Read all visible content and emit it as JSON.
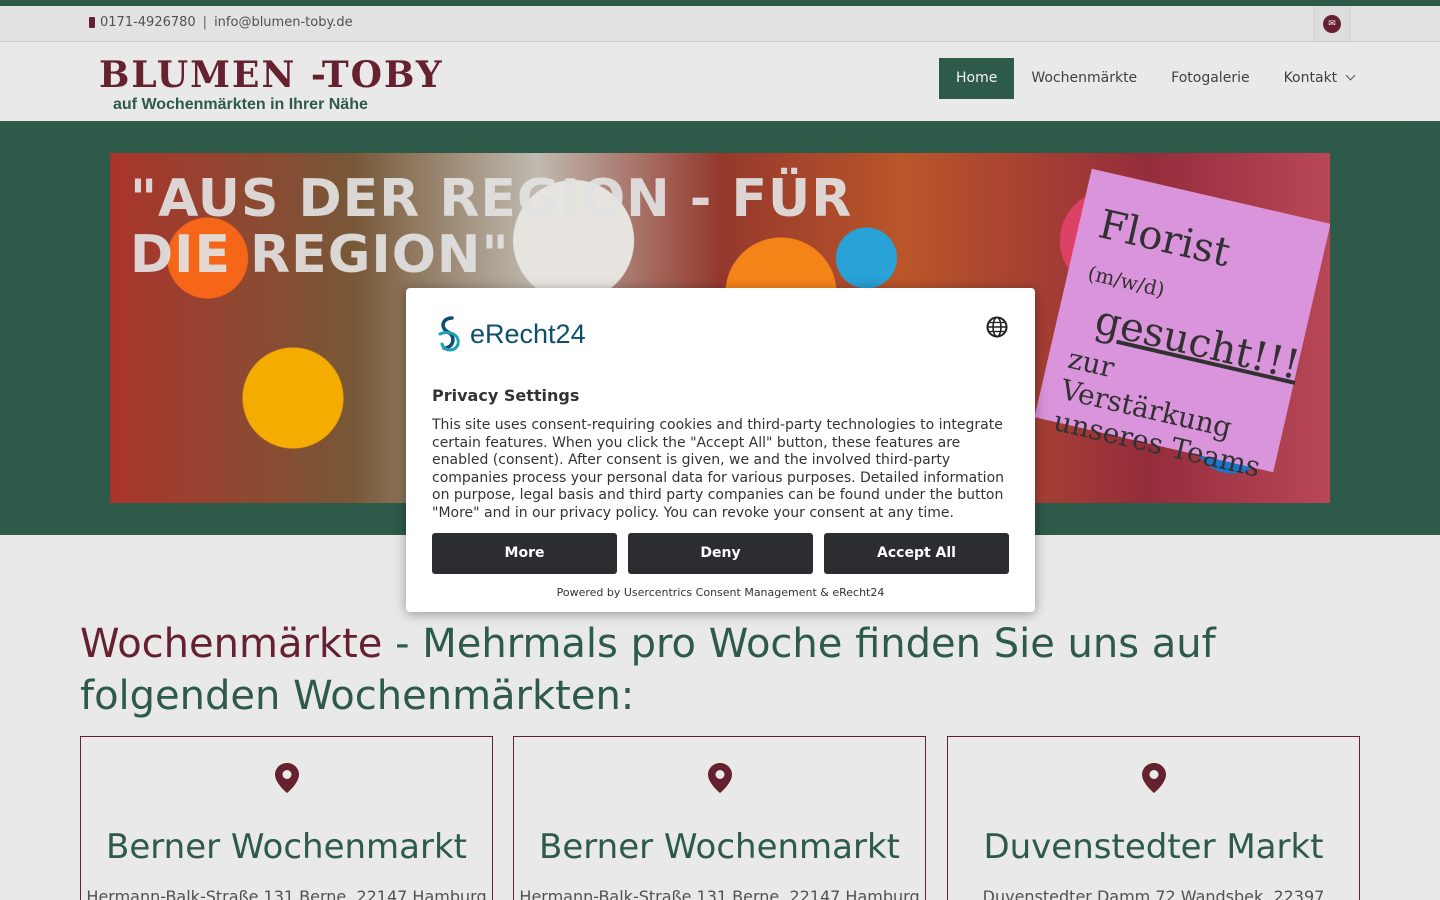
{
  "topbar": {
    "phone": "0171-4926780",
    "separator": "|",
    "email": "info@blumen-toby.de",
    "phone_icon": "mobile-phone-icon",
    "mail_icon": "envelope-icon"
  },
  "header": {
    "logo_title": "BLUMEN -TOBY",
    "logo_subtitle": "auf Wochenmärkten in Ihrer Nähe",
    "nav": [
      {
        "label": "Home",
        "active": true
      },
      {
        "label": "Wochenmärkte"
      },
      {
        "label": "Fotogalerie"
      },
      {
        "label": "Kontakt",
        "dropdown": true
      }
    ]
  },
  "hero": {
    "title": "\"AUS DER REGION - FÜR DIE REGION\"",
    "note_line1": "Florist",
    "note_line1_small": "(m/w/d)",
    "note_line2": "gesucht!!!",
    "note_line3": "zur Verstärkung unseres Teams"
  },
  "main": {
    "heading_accent": "Wochenmärkte",
    "heading_rest": " - Mehrmals pro Woche finden Sie uns auf folgenden Wochenmärkten:",
    "cards": [
      {
        "title": "Berner Wochenmarkt",
        "address": "Hermann-Balk-Straße 131 Berne, 22147 Hamburg"
      },
      {
        "title": "Berner Wochenmarkt",
        "address": "Hermann-Balk-Straße 131 Berne, 22147 Hamburg"
      },
      {
        "title": "Duvenstedter Markt",
        "address": "Duvenstedter Damm 72 Wandsbek, 22397"
      }
    ]
  },
  "consent": {
    "brand": "eRecht24",
    "title": "Privacy Settings",
    "text": "This site uses consent-requiring cookies and third-party technologies to integrate certain features. When you click the \"Accept All\" button, these features are enabled (consent). After consent is given, we and the involved third-party companies process your personal data for various purposes. Detailed information on purpose, legal basis and third party companies can be found under the button \"More\" and in our privacy policy. You can revoke your consent at any time.",
    "btn_more": "More",
    "btn_deny": "Deny",
    "btn_accept": "Accept All",
    "powered": "Powered by Usercentrics Consent Management & eRecht24"
  },
  "colors": {
    "brand_green": "#2f5e4d",
    "brand_maroon": "#6b2334",
    "button_dark": "#2b2d31"
  }
}
